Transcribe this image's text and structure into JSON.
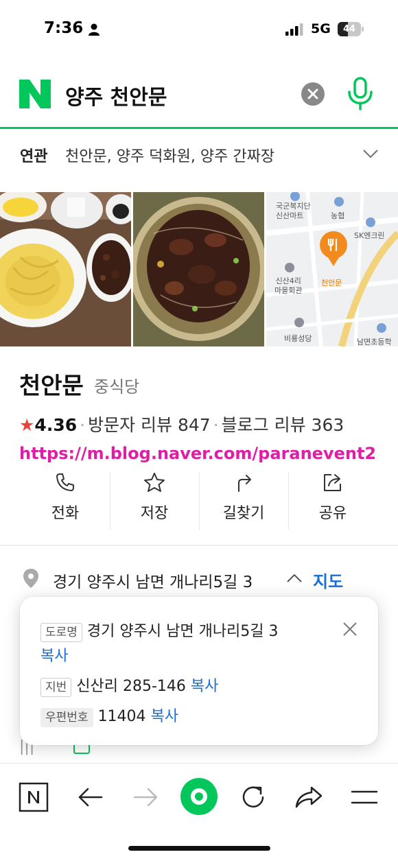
{
  "status_bar": {
    "time": "7:36",
    "network": "5G",
    "battery": "44",
    "battery_level": 0.44
  },
  "search": {
    "query": "양주 천안문"
  },
  "related": {
    "label": "연관",
    "items": "천안문, 양주 덕화원, 양주 간짜장"
  },
  "map": {
    "labels": [
      "국군복지단",
      "신산마트",
      "농협",
      "SK엔크린",
      "신산4리",
      "마을회관",
      "천안문",
      "비룡성당",
      "남면초등학"
    ]
  },
  "place": {
    "name": "천안문",
    "category": "중식당",
    "star": "★",
    "rating": "4.36",
    "visitor_reviews": "방문자 리뷰 847",
    "blog_reviews": "블로그 리뷰 363",
    "blog_link": "https://m.blog.naver.com/paranevent2"
  },
  "actions": [
    {
      "label": "전화",
      "icon": "phone-icon"
    },
    {
      "label": "저장",
      "icon": "star-outline-icon"
    },
    {
      "label": "길찾기",
      "icon": "directions-icon"
    },
    {
      "label": "공유",
      "icon": "share-icon"
    }
  ],
  "address": {
    "text": "경기 양주시 남면 개나리5길 3",
    "map_link": "지도"
  },
  "address_popup": {
    "road_tag": "도로명",
    "road_address": "경기 양주시 남면 개나리5길 3",
    "road_copy": "복사",
    "jibun_tag": "지번",
    "jibun_address": "신산리 285-146",
    "jibun_copy": "복사",
    "zip_tag": "우편번호",
    "zip_code": "11404",
    "zip_copy": "복사"
  },
  "colors": {
    "naver_green": "#03c75a",
    "link_blue": "#1a6fd6",
    "blog_pink": "#e01ea5",
    "star_red": "#e8443a"
  }
}
